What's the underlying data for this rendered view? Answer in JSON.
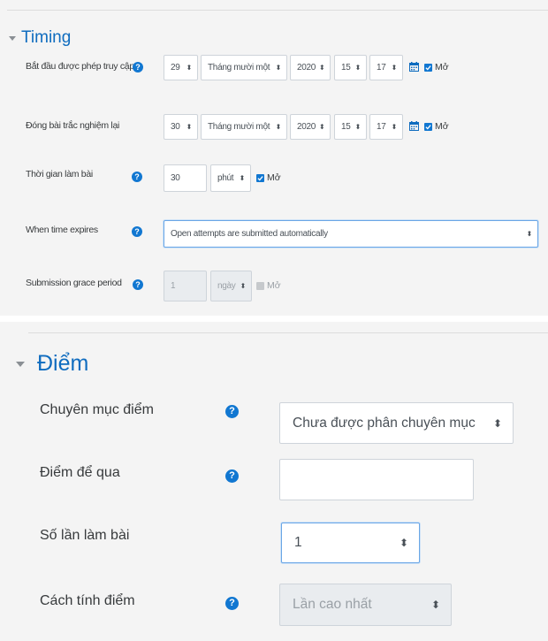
{
  "timing": {
    "legend": "Timing",
    "open": {
      "label": "Bắt đầu được phép truy cập",
      "day": "29",
      "month": "Tháng mười một",
      "year": "2020",
      "hour": "15",
      "minute": "17",
      "enable_label": "Mở",
      "enabled": true
    },
    "close": {
      "label": "Đóng bài trắc nghiệm lại",
      "day": "30",
      "month": "Tháng mười một",
      "year": "2020",
      "hour": "15",
      "minute": "17",
      "enable_label": "Mở",
      "enabled": true
    },
    "time_limit": {
      "label": "Thời gian làm bài",
      "value": "30",
      "unit": "phút",
      "enable_label": "Mở",
      "enabled": true
    },
    "when_expires": {
      "label": "When time expires",
      "value": "Open attempts are submitted automatically"
    },
    "grace_period": {
      "label": "Submission grace period",
      "value": "1",
      "unit": "ngày",
      "enable_label": "Mở",
      "enabled": false
    }
  },
  "grade": {
    "legend": "Điểm",
    "category": {
      "label": "Chuyên mục điểm",
      "value": "Chưa được phân chuyên mục"
    },
    "pass": {
      "label": "Điểm để qua",
      "value": ""
    },
    "attempts": {
      "label": "Số lần làm bài",
      "value": "1"
    },
    "method": {
      "label": "Cách tính điểm",
      "value": "Lần cao nhất"
    }
  },
  "colors": {
    "accent": "#0f6cbf",
    "help_icon": "#1177d1",
    "panel_bg": "#f4f4f4"
  },
  "icons": {
    "help": "question-circle-icon",
    "calendar": "calendar-icon",
    "select_arrows": "updown-arrows-icon",
    "collapse": "caret-down-icon"
  }
}
